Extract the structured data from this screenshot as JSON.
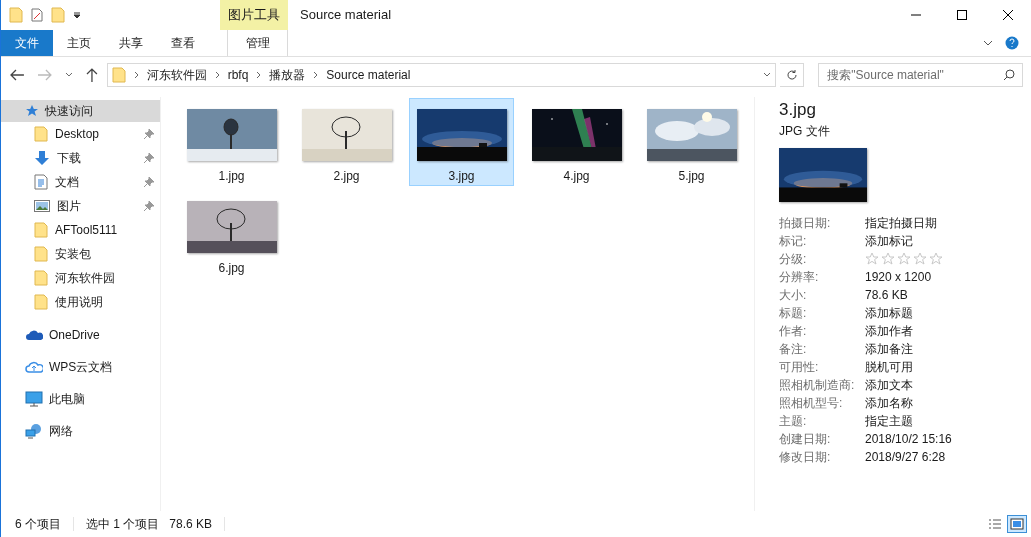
{
  "window": {
    "title": "Source material",
    "context_tab_group": "图片工具"
  },
  "ribbon_tabs": [
    {
      "label": "文件",
      "kind": "file",
      "selected": false
    },
    {
      "label": "主页",
      "kind": "tab",
      "selected": false
    },
    {
      "label": "共享",
      "kind": "tab",
      "selected": false
    },
    {
      "label": "查看",
      "kind": "tab",
      "selected": false
    },
    {
      "label": "管理",
      "kind": "context",
      "selected": false
    }
  ],
  "address": {
    "path": [
      "河东软件园",
      "rbfq",
      "播放器",
      "Source material"
    ]
  },
  "search": {
    "placeholder": "搜索\"Source material\""
  },
  "sidebar": [
    {
      "label": "快速访问",
      "kind": "star",
      "selected": true,
      "children": [
        {
          "label": "Desktop",
          "kind": "folder",
          "pinned": true
        },
        {
          "label": "下载",
          "kind": "download",
          "pinned": true
        },
        {
          "label": "文档",
          "kind": "document",
          "pinned": true
        },
        {
          "label": "图片",
          "kind": "pictures",
          "pinned": true
        },
        {
          "label": "AFTool5111",
          "kind": "folder",
          "pinned": false
        },
        {
          "label": "安装包",
          "kind": "folder",
          "pinned": false
        },
        {
          "label": "河东软件园",
          "kind": "folder",
          "pinned": false
        },
        {
          "label": "使用说明",
          "kind": "folder",
          "pinned": false
        }
      ]
    },
    {
      "label": "OneDrive",
      "kind": "onedrive",
      "selected": false
    },
    {
      "label": "WPS云文档",
      "kind": "cloud",
      "selected": false
    },
    {
      "label": "此电脑",
      "kind": "pc",
      "selected": false
    },
    {
      "label": "网络",
      "kind": "network",
      "selected": false
    }
  ],
  "files": [
    {
      "name": "1.jpg",
      "selected": false
    },
    {
      "name": "2.jpg",
      "selected": false
    },
    {
      "name": "3.jpg",
      "selected": true
    },
    {
      "name": "4.jpg",
      "selected": false
    },
    {
      "name": "5.jpg",
      "selected": false
    },
    {
      "name": "6.jpg",
      "selected": false
    }
  ],
  "details": {
    "name": "3.jpg",
    "type": "JPG 文件",
    "properties": [
      {
        "label": "拍摄日期:",
        "value": "指定拍摄日期",
        "kind": "text"
      },
      {
        "label": "标记:",
        "value": "添加标记",
        "kind": "text"
      },
      {
        "label": "分级:",
        "stars": 0,
        "kind": "rating"
      },
      {
        "label": "分辨率:",
        "value": "1920 x 1200",
        "kind": "text"
      },
      {
        "label": "大小:",
        "value": "78.6 KB",
        "kind": "text"
      },
      {
        "label": "标题:",
        "value": "添加标题",
        "kind": "text"
      },
      {
        "label": "作者:",
        "value": "添加作者",
        "kind": "text"
      },
      {
        "label": "备注:",
        "value": "添加备注",
        "kind": "text"
      },
      {
        "label": "可用性:",
        "value": "脱机可用",
        "kind": "text"
      },
      {
        "label": "照相机制造商:",
        "value": "添加文本",
        "kind": "text"
      },
      {
        "label": "照相机型号:",
        "value": "添加名称",
        "kind": "text"
      },
      {
        "label": "主题:",
        "value": "指定主题",
        "kind": "text"
      },
      {
        "label": "创建日期:",
        "value": "2018/10/2 15:16",
        "kind": "text"
      },
      {
        "label": "修改日期:",
        "value": "2018/9/27 6:28",
        "kind": "text"
      }
    ]
  },
  "status_bar": {
    "item_count": "6 个项目",
    "selection": "选中 1 个项目",
    "selection_size": "78.6 KB",
    "views": [
      {
        "kind": "details",
        "selected": false
      },
      {
        "kind": "large",
        "selected": true
      }
    ]
  }
}
